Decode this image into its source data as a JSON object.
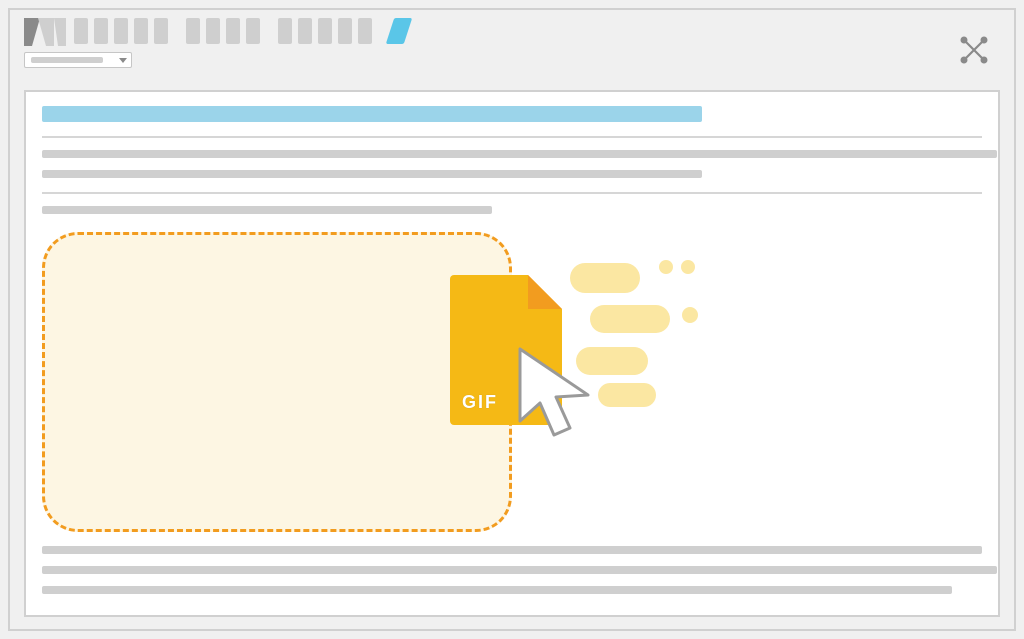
{
  "file": {
    "type_label": "GIF"
  },
  "colors": {
    "accent": "#5ac6e8",
    "title_highlight": "#9bd4ea",
    "file_fill": "#f5b915",
    "file_fold": "#f29c1f",
    "dropzone_border": "#f29c1f",
    "dropzone_fill": "#fdf6e3",
    "placeholder": "#cfcfcf"
  }
}
